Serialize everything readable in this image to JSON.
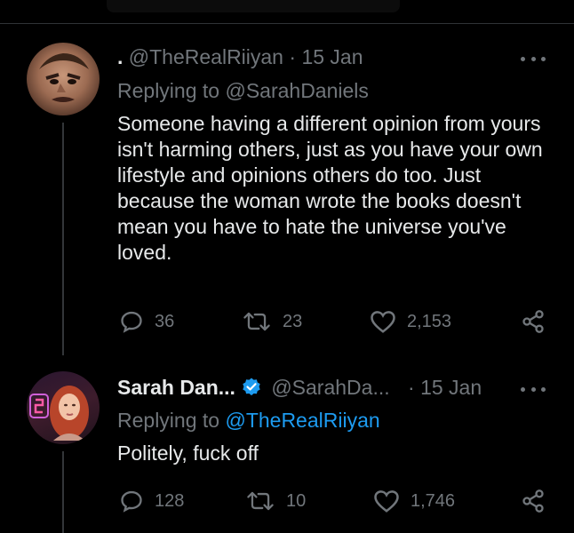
{
  "tweets": [
    {
      "name": ".",
      "handle": "@TheRealRiiyan",
      "separator": "·",
      "date": "15 Jan",
      "reply_prefix": "Replying to",
      "reply_handle": "@SarahDaniels",
      "text": "Someone having a different opinion from yours isn't harming others, just as you have your own lifestyle and opinions others do too. Just because the woman wrote the books doesn't mean you have to hate the universe you've loved.",
      "replies": "36",
      "retweets": "23",
      "likes": "2,153"
    },
    {
      "name": "Sarah Dan...",
      "verified": true,
      "handle": "@SarahDa...",
      "separator": "·",
      "date": "15 Jan",
      "reply_prefix": "Replying to",
      "reply_handle": "@TheRealRiiyan",
      "text": "Politely, fuck off",
      "replies": "128",
      "retweets": "10",
      "likes": "1,746"
    }
  ],
  "colors": {
    "background": "#000000",
    "text": "#e7e9ea",
    "muted": "#71767b",
    "link": "#1d9bf0",
    "verified": "#1d9bf0"
  },
  "icons": [
    "more-icon",
    "reply-icon",
    "retweet-icon",
    "like-icon",
    "share-icon",
    "verified-badge-icon"
  ]
}
